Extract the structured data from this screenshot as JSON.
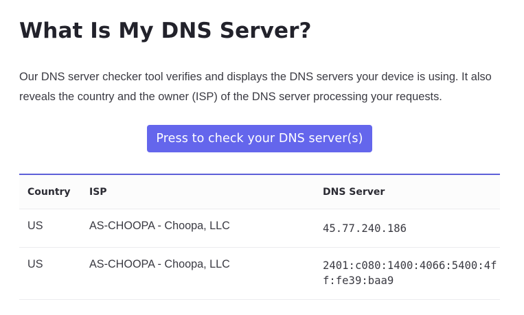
{
  "page": {
    "title": "What Is My DNS Server?",
    "description": "Our DNS server checker tool verifies and displays the DNS servers your device is using. It also reveals the country and the owner (ISP) of the DNS server processing your requests.",
    "check_button_label": "Press to check your DNS server(s)"
  },
  "colors": {
    "accent": "#6466ec",
    "table_rule": "#5d5fd8",
    "heading": "#22222b"
  },
  "table": {
    "headers": [
      "Country",
      "ISP",
      "DNS Server"
    ],
    "rows": [
      {
        "country": "US",
        "isp": "AS-CHOOPA - Choopa, LLC",
        "dns": "45.77.240.186"
      },
      {
        "country": "US",
        "isp": "AS-CHOOPA - Choopa, LLC",
        "dns": "2401:c080:1400:4066:5400:4ff:fe39:baa9"
      }
    ]
  }
}
